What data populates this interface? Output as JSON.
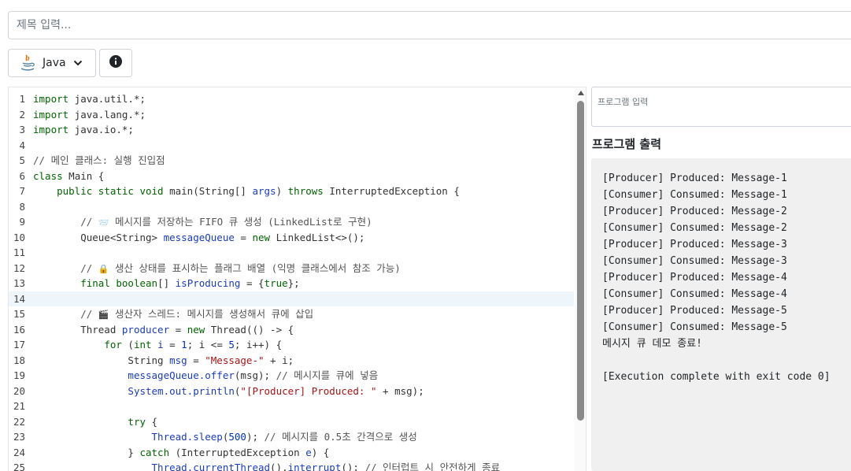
{
  "title_input": {
    "placeholder": "제목 입력...",
    "value": ""
  },
  "language_selector": {
    "label": "Java",
    "icon": "java-icon"
  },
  "info_button": {
    "icon": "info-icon"
  },
  "editor": {
    "active_line": 14,
    "line_numbers": [
      "1",
      "2",
      "3",
      "4",
      "5",
      "6",
      "7",
      "8",
      "9",
      "10",
      "11",
      "12",
      "13",
      "14",
      "15",
      "16",
      "17",
      "18",
      "19",
      "20",
      "21",
      "22",
      "23",
      "24",
      "25"
    ]
  },
  "stdin": {
    "placeholder": "프로그램 입력",
    "value": ""
  },
  "output": {
    "heading": "프로그램 출력",
    "lines": [
      "[Producer] Produced: Message-1",
      "[Consumer] Consumed: Message-1",
      "[Producer] Produced: Message-2",
      "[Consumer] Consumed: Message-2",
      "[Producer] Produced: Message-3",
      "[Consumer] Consumed: Message-3",
      "[Producer] Produced: Message-4",
      "[Consumer] Consumed: Message-4",
      "[Producer] Produced: Message-5",
      "[Consumer] Consumed: Message-5",
      "메시지 큐 데모 종료!",
      "",
      "[Execution complete with exit code 0]"
    ]
  }
}
